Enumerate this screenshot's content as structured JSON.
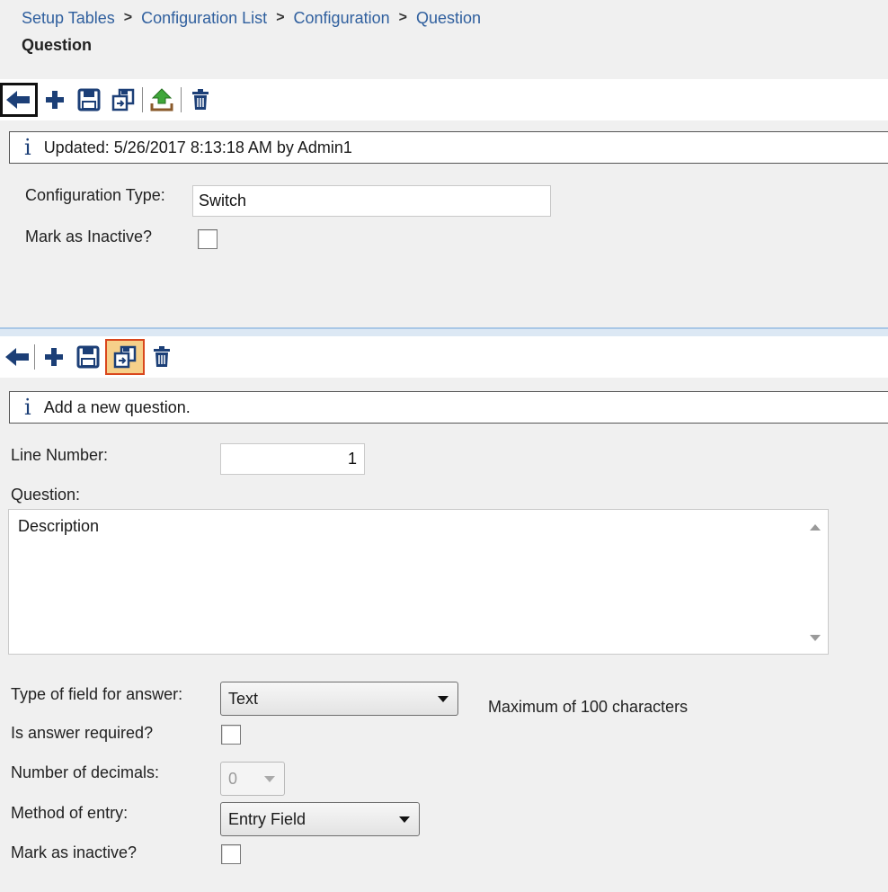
{
  "breadcrumb": {
    "items": [
      "Setup Tables",
      "Configuration List",
      "Configuration"
    ],
    "current": "Question",
    "separator": ">"
  },
  "page": {
    "title": "Question"
  },
  "colors": {
    "link": "#2f5f9e",
    "icon": "#1c3f77",
    "upload_green": "#3fa73a",
    "active_border": "#d9471d"
  },
  "header_section": {
    "toolbar_icons": [
      "back-arrow-icon",
      "add-icon",
      "save-icon",
      "copy-icon",
      "upload-icon",
      "delete-icon"
    ],
    "info": {
      "text": "Updated: 5/26/2017 8:13:18 AM by Admin1"
    },
    "configuration_type": {
      "label": "Configuration Type:",
      "value": "Switch"
    },
    "mark_inactive": {
      "label": "Mark as Inactive?",
      "checked": false
    }
  },
  "question_section": {
    "toolbar_icons": [
      "back-arrow-icon",
      "add-icon",
      "save-icon",
      "copy-icon",
      "delete-icon"
    ],
    "info": {
      "text": "Add a new question."
    },
    "line_number": {
      "label": "Line Number:",
      "value": "1"
    },
    "question": {
      "label": "Question:",
      "value": "Description"
    },
    "answer_type": {
      "label": "Type of field for answer:",
      "selected": "Text",
      "hint": "Maximum of 100 characters"
    },
    "answer_required": {
      "label": "Is answer required?",
      "checked": false
    },
    "decimals": {
      "label": "Number of decimals:",
      "selected": "0"
    },
    "entry_method": {
      "label": "Method of entry:",
      "selected": "Entry Field"
    },
    "mark_inactive": {
      "label": "Mark as inactive?",
      "checked": false
    }
  }
}
